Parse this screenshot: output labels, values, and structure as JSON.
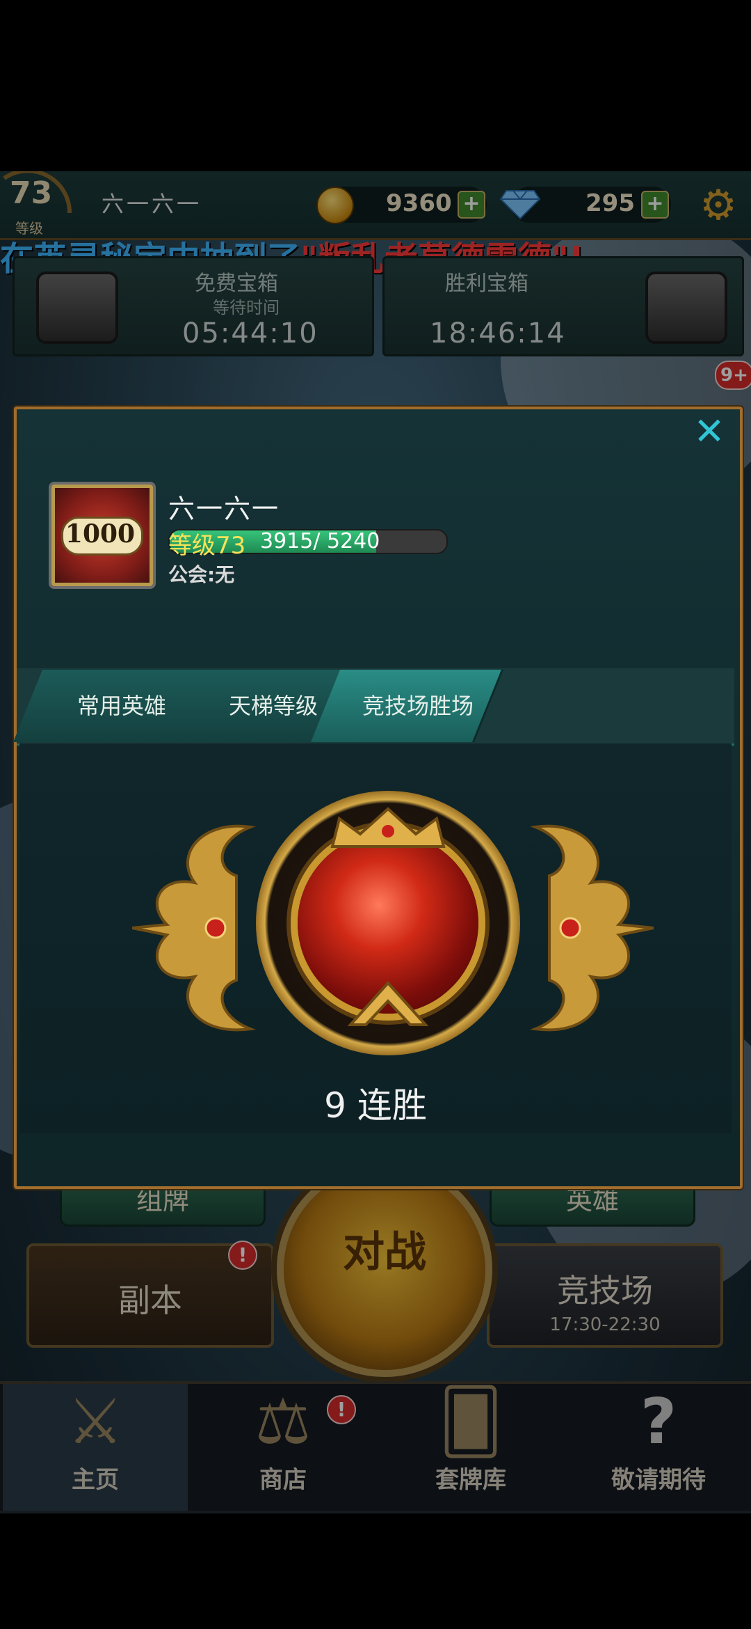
{
  "header": {
    "level": "73",
    "level_caption": "等级",
    "player_name": "六一六一",
    "gold": "9360",
    "gems": "295",
    "plus": "+"
  },
  "broadcast": {
    "prefix": "在英灵秘宝中抽到了",
    "highlight": "\"叛乱者莫德雷德\"",
    "suffix": "!"
  },
  "chests": [
    {
      "title": "免费宝箱",
      "subtitle": "等待时间",
      "timer": "05:44:10"
    },
    {
      "title": "胜利宝箱",
      "subtitle": "",
      "timer": "18:46:14"
    }
  ],
  "notif_count": "9+",
  "main": {
    "deck_label": "组牌",
    "hero_label": "英雄",
    "fight_label": "对战",
    "dungeon_label": "副本",
    "arena_label": "竞技场",
    "arena_hours": "17:30-22:30",
    "badge": "!"
  },
  "nav": [
    {
      "label": "主页",
      "active": true
    },
    {
      "label": "商店",
      "active": false
    },
    {
      "label": "套牌库",
      "active": false
    },
    {
      "label": "敬请期待",
      "active": false
    }
  ],
  "profile": {
    "close": "✕",
    "avatar_score": "1000",
    "name": "六一六一",
    "level_label": "等级",
    "level_value": "73",
    "xp_text": "3915/ 5240",
    "xp_current": 3915,
    "xp_max": 5240,
    "guild": "公会:无",
    "tabs": [
      "常用英雄",
      "天梯等级",
      "竞技场胜场"
    ],
    "active_tab": 2,
    "streak": "9 连胜"
  },
  "colors": {
    "broadcast_blue": "#3fb6ff",
    "broadcast_red": "#ff3b3b",
    "modal_border": "#a06d2d",
    "close_cyan": "#30c6d6",
    "level_yellow": "#f5e35a",
    "xp_green": "#36c47a"
  },
  "icons": {
    "settings": "gear-icon",
    "gold": "coin-icon",
    "gems": "diamond-icon",
    "home": "crossed-swords-icon",
    "shop": "scales-icon",
    "deck": "cards-icon",
    "soon": "question-icon"
  }
}
